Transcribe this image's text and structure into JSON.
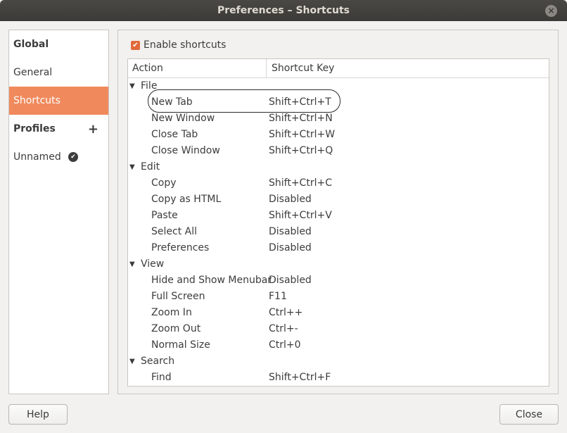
{
  "window": {
    "title": "Preferences – Shortcuts",
    "close_glyph": "×"
  },
  "sidebar": {
    "items": [
      {
        "label": "Global",
        "bold": true
      },
      {
        "label": "General"
      },
      {
        "label": "Shortcuts",
        "selected": true
      },
      {
        "label": "Profiles",
        "bold": true,
        "icon": "plus-icon"
      },
      {
        "label": "Unnamed",
        "icon": "check-circle-icon"
      }
    ],
    "plus_glyph": "+",
    "check_glyph": "✔"
  },
  "content": {
    "enable_label": "Enable shortcuts",
    "enable_checked": true,
    "check_glyph": "✔",
    "columns": {
      "action": "Action",
      "key": "Shortcut Key"
    },
    "expand_glyph": "▼",
    "groups": [
      {
        "label": "File",
        "items": [
          {
            "action": "New Tab",
            "key": "Shift+Ctrl+T"
          },
          {
            "action": "New Window",
            "key": "Shift+Ctrl+N"
          },
          {
            "action": "Close Tab",
            "key": "Shift+Ctrl+W"
          },
          {
            "action": "Close Window",
            "key": "Shift+Ctrl+Q"
          }
        ]
      },
      {
        "label": "Edit",
        "items": [
          {
            "action": "Copy",
            "key": "Shift+Ctrl+C"
          },
          {
            "action": "Copy as HTML",
            "key": "Disabled"
          },
          {
            "action": "Paste",
            "key": "Shift+Ctrl+V"
          },
          {
            "action": "Select All",
            "key": "Disabled"
          },
          {
            "action": "Preferences",
            "key": "Disabled"
          }
        ]
      },
      {
        "label": "View",
        "items": [
          {
            "action": "Hide and Show Menubar",
            "key": "Disabled"
          },
          {
            "action": "Full Screen",
            "key": "F11"
          },
          {
            "action": "Zoom In",
            "key": "Ctrl++"
          },
          {
            "action": "Zoom Out",
            "key": "Ctrl+-"
          },
          {
            "action": "Normal Size",
            "key": "Ctrl+0"
          }
        ]
      },
      {
        "label": "Search",
        "items": [
          {
            "action": "Find",
            "key": "Shift+Ctrl+F"
          }
        ]
      }
    ]
  },
  "footer": {
    "help_label": "Help",
    "close_label": "Close"
  },
  "colors": {
    "accent": "#f08a5d",
    "checkbox": "#e26a3a",
    "titlebar": "#3b3a36"
  }
}
